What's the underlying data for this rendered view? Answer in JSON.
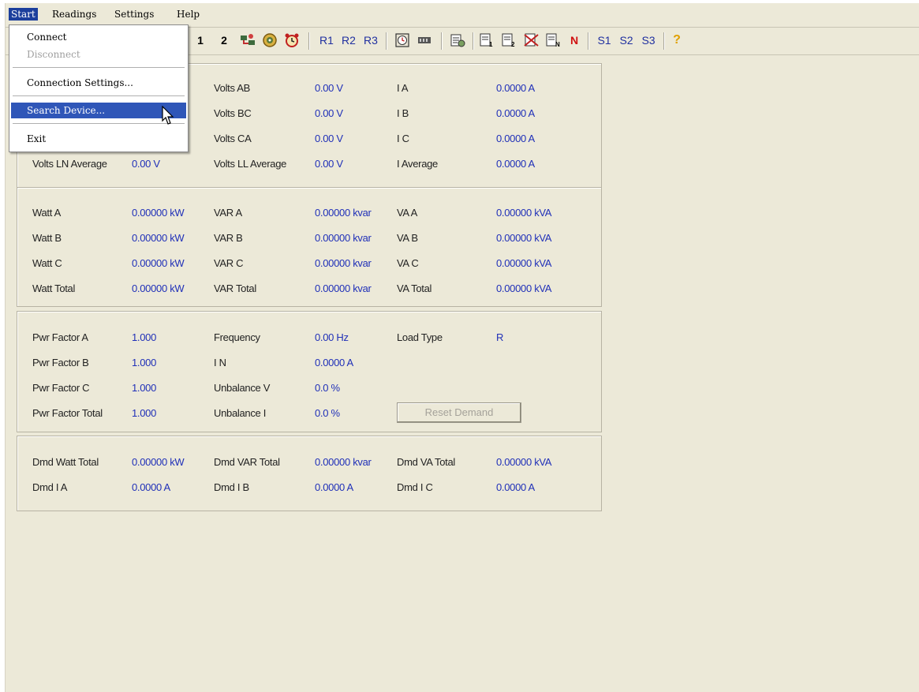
{
  "menubar": {
    "start": "Start",
    "readings": "Readings",
    "settings": "Settings",
    "help": "Help"
  },
  "start_menu": {
    "connect": "Connect",
    "disconnect": "Disconnect",
    "connection_settings": "Connection Settings...",
    "search_device": "Search Device...",
    "exit": "Exit"
  },
  "toolbar": {
    "btn_1": "1",
    "btn_2": "2",
    "r1": "R1",
    "r2": "R2",
    "r3": "R3",
    "n": "N",
    "s1": "S1",
    "s2": "S2",
    "s3": "S3",
    "help": "?"
  },
  "voltage_current": {
    "rows": [
      {
        "l1": "",
        "v1": "",
        "l2": "Volts AB",
        "v2": "0.00 V",
        "l3": "I A",
        "v3": "0.0000 A"
      },
      {
        "l1": "",
        "v1": "",
        "l2": "Volts BC",
        "v2": "0.00 V",
        "l3": "I B",
        "v3": "0.0000 A"
      },
      {
        "l1": "",
        "v1": "",
        "l2": "Volts CA",
        "v2": "0.00 V",
        "l3": "I C",
        "v3": "0.0000 A"
      },
      {
        "l1": "Volts LN Average",
        "v1": "0.00 V",
        "l2": "Volts LL Average",
        "v2": "0.00 V",
        "l3": "I Average",
        "v3": "0.0000 A"
      }
    ]
  },
  "power": {
    "rows": [
      {
        "l1": "Watt A",
        "v1": "0.00000 kW",
        "l2": "VAR A",
        "v2": "0.00000 kvar",
        "l3": "VA A",
        "v3": "0.00000 kVA"
      },
      {
        "l1": "Watt B",
        "v1": "0.00000 kW",
        "l2": "VAR B",
        "v2": "0.00000 kvar",
        "l3": "VA B",
        "v3": "0.00000 kVA"
      },
      {
        "l1": "Watt C",
        "v1": "0.00000 kW",
        "l2": "VAR C",
        "v2": "0.00000 kvar",
        "l3": "VA C",
        "v3": "0.00000 kVA"
      },
      {
        "l1": "Watt Total",
        "v1": "0.00000 kW",
        "l2": "VAR Total",
        "v2": "0.00000 kvar",
        "l3": "VA Total",
        "v3": "0.00000 kVA"
      }
    ]
  },
  "pf_freq": {
    "rows": [
      {
        "l1": "Pwr Factor A",
        "v1": "1.000",
        "l2": "Frequency",
        "v2": "0.00 Hz",
        "l3": "Load Type",
        "v3": "R"
      },
      {
        "l1": "Pwr Factor B",
        "v1": "1.000",
        "l2": "I N",
        "v2": "0.0000 A",
        "l3": "",
        "v3": ""
      },
      {
        "l1": "Pwr Factor C",
        "v1": "1.000",
        "l2": "Unbalance V",
        "v2": "0.0 %",
        "l3": "",
        "v3": ""
      },
      {
        "l1": "Pwr Factor Total",
        "v1": "1.000",
        "l2": "Unbalance I",
        "v2": "0.0 %",
        "l3": "",
        "v3": ""
      }
    ],
    "reset_demand": "Reset Demand"
  },
  "demand": {
    "rows": [
      {
        "l1": "Dmd Watt Total",
        "v1": "0.00000 kW",
        "l2": "Dmd VAR Total",
        "v2": "0.00000 kvar",
        "l3": "Dmd VA Total",
        "v3": "0.00000 kVA"
      },
      {
        "l1": "Dmd I A",
        "v1": "0.0000 A",
        "l2": "Dmd I B",
        "v2": "0.0000 A",
        "l3": "Dmd I C",
        "v3": "0.0000 A"
      }
    ]
  }
}
